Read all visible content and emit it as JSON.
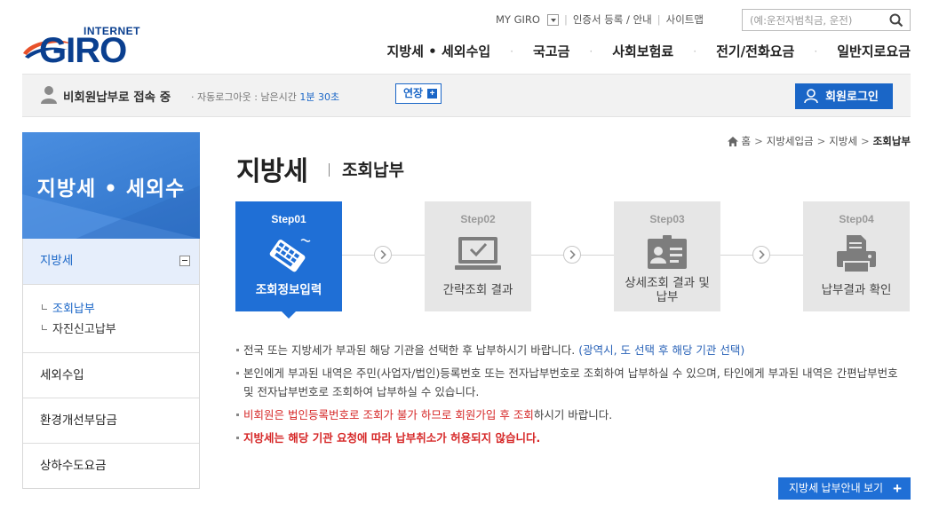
{
  "logo": {
    "top": "INTERNET",
    "main": "GIRO"
  },
  "util_links": [
    "MY GIRO",
    "인증서 등록 / 안내",
    "사이트맵"
  ],
  "search": {
    "placeholder": "(예:운전자범칙금, 운전)"
  },
  "gnb": [
    "지방세 • 세외수입",
    "국고금",
    "사회보험료",
    "전기/전화요금",
    "일반지로요금"
  ],
  "status": {
    "connection": "비회원납부로 접속 중",
    "auto_logout_label": "· 자동로그아웃 : 남은시간",
    "remaining": "1분 30초",
    "extend_label": "연장",
    "login_label": "회원로그인"
  },
  "lnb": {
    "title": "지방세 • 세외수",
    "active_item": "지방세",
    "sub_items": [
      "조회납부",
      "자진신고납부"
    ],
    "items": [
      "세외수입",
      "환경개선부담금",
      "상하수도요금"
    ]
  },
  "breadcrumb": [
    "홈",
    "지방세입금",
    "지방세",
    "조회납부"
  ],
  "page": {
    "title": "지방세",
    "subtitle": "조회납부"
  },
  "steps": [
    {
      "no": "Step01",
      "label": "조회정보입력"
    },
    {
      "no": "Step02",
      "label": "간략조회 결과"
    },
    {
      "no": "Step03",
      "label": "상세조회 결과 및 납부"
    },
    {
      "no": "Step04",
      "label": "납부결과 확인"
    }
  ],
  "notes": {
    "n1_text": "전국 또는 지방세가 부과된 해당 기관을 선택한 후 납부하시기 바랍니다. ",
    "n1_blue": "(광역시, 도 선택 후 해당 기관 선택)",
    "n2_text": "본인에게 부과된 내역은 주민(사업자/법인)등록번호 또는 전자납부번호로 조회하여 납부하실 수 있으며, 타인에게 부과된 내역은 간편납부번호 및 전자납부번호로 조회하여 납부하실 수 있습니다.",
    "n3_red": "비회원은 법인등록번호로 조회가 불가 하므로 회원가입 후 조회",
    "n3_text": "하시기 바랍니다.",
    "n4_redb": "지방세는 해당 기관 요청에 따라 납부취소가 허용되지 않습니다."
  },
  "guide_button": "지방세 납부안내 보기",
  "colors": {
    "primary": "#1f6fd6",
    "logo": "#0a3f8f",
    "alert": "#d62828"
  }
}
